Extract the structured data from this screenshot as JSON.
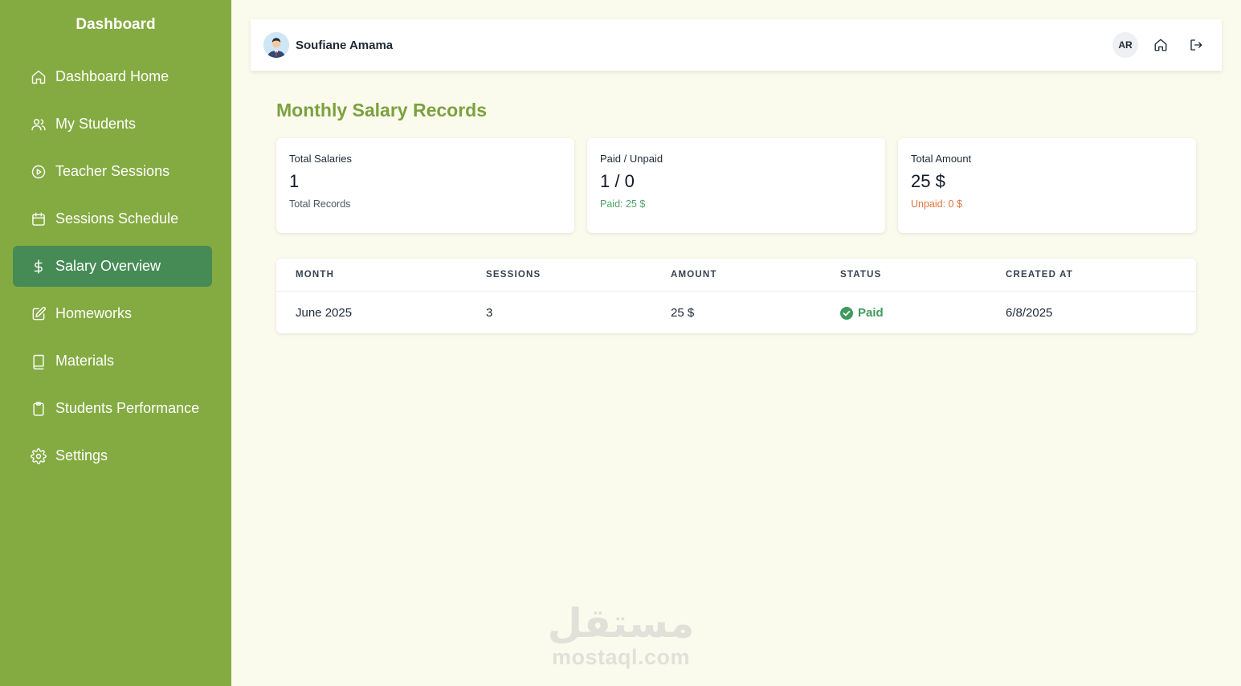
{
  "sidebar": {
    "title": "Dashboard",
    "items": [
      {
        "label": "Dashboard Home",
        "icon": "home-icon"
      },
      {
        "label": "My Students",
        "icon": "users-icon"
      },
      {
        "label": "Teacher Sessions",
        "icon": "play-circle-icon"
      },
      {
        "label": "Sessions Schedule",
        "icon": "calendar-icon"
      },
      {
        "label": "Salary Overview",
        "icon": "dollar-icon",
        "active": true
      },
      {
        "label": "Homeworks",
        "icon": "edit-icon"
      },
      {
        "label": "Materials",
        "icon": "book-icon"
      },
      {
        "label": "Students Performance",
        "icon": "clipboard-icon"
      },
      {
        "label": "Settings",
        "icon": "gear-icon"
      }
    ]
  },
  "header": {
    "user_name": "Soufiane Amama",
    "language_label": "AR"
  },
  "main": {
    "title": "Monthly Salary Records",
    "cards": [
      {
        "label": "Total Salaries",
        "value": "1",
        "sub": "Total Records"
      },
      {
        "label": "Paid / Unpaid",
        "value": "1 / 0",
        "sub": "Paid: 25 $"
      },
      {
        "label": "Total Amount",
        "value": "25 $",
        "sub": "Unpaid: 0 $"
      }
    ],
    "table": {
      "headers": [
        "MONTH",
        "SESSIONS",
        "AMOUNT",
        "STATUS",
        "CREATED AT"
      ],
      "rows": [
        {
          "month": "June 2025",
          "sessions": "3",
          "amount": "25 $",
          "status": "Paid",
          "created_at": "6/8/2025"
        }
      ]
    }
  },
  "watermark": {
    "logo": "مستقل",
    "text": "mostaql.com"
  },
  "colors": {
    "sidebar": "#84ab41",
    "active_item": "#468b56",
    "title": "#7ca13f",
    "paid": "#3f9a5d",
    "unpaid": "#e0733c",
    "background": "#fafbec"
  }
}
